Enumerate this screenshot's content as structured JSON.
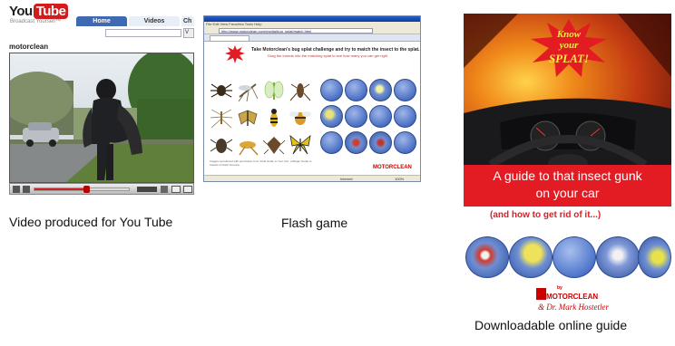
{
  "youtube": {
    "logo_you": "You",
    "logo_tube": "Tube",
    "tagline": "Broadcast Yourself™",
    "tabs": [
      "Home",
      "Videos",
      "Ch"
    ],
    "search_button": "V",
    "username": "motorclean",
    "progress_fraction": 0.55
  },
  "flash_game": {
    "menu": "File  Edit  View  Favorites  Tools  Help",
    "url": "http://www.motorclean.com/media/bug_splat/match.html",
    "heading": "Take Motorclean's bug splat challenge and try to match the insect to the splat.",
    "subheading": "Drag the insects into the matching splat to see how many you can get right",
    "fine_print": "Images reproduced with permission from 'Field Guide to Your Car', a Bolger Guide to Insects of North America.",
    "logo": "MOTORCLEAN",
    "status_zone": "Internet",
    "status_zoom": "100%"
  },
  "guide": {
    "title_art": [
      "Know",
      "your",
      "SPLAT!"
    ],
    "band_line1": "A guide to that insect gunk",
    "band_line2": "on your car",
    "subtitle": "(and how to get rid of it...)",
    "by": "by",
    "brand": "MOTORCLEAN",
    "author": "& Dr. Mark Hostetler"
  },
  "captions": {
    "youtube": "Video produced for You Tube",
    "flash": "Flash game",
    "guide": "Downloadable online guide"
  },
  "colors": {
    "brand_red": "#e31b23",
    "youtube_red": "#d21b1b",
    "splat_blue": "#4a6fc4"
  }
}
